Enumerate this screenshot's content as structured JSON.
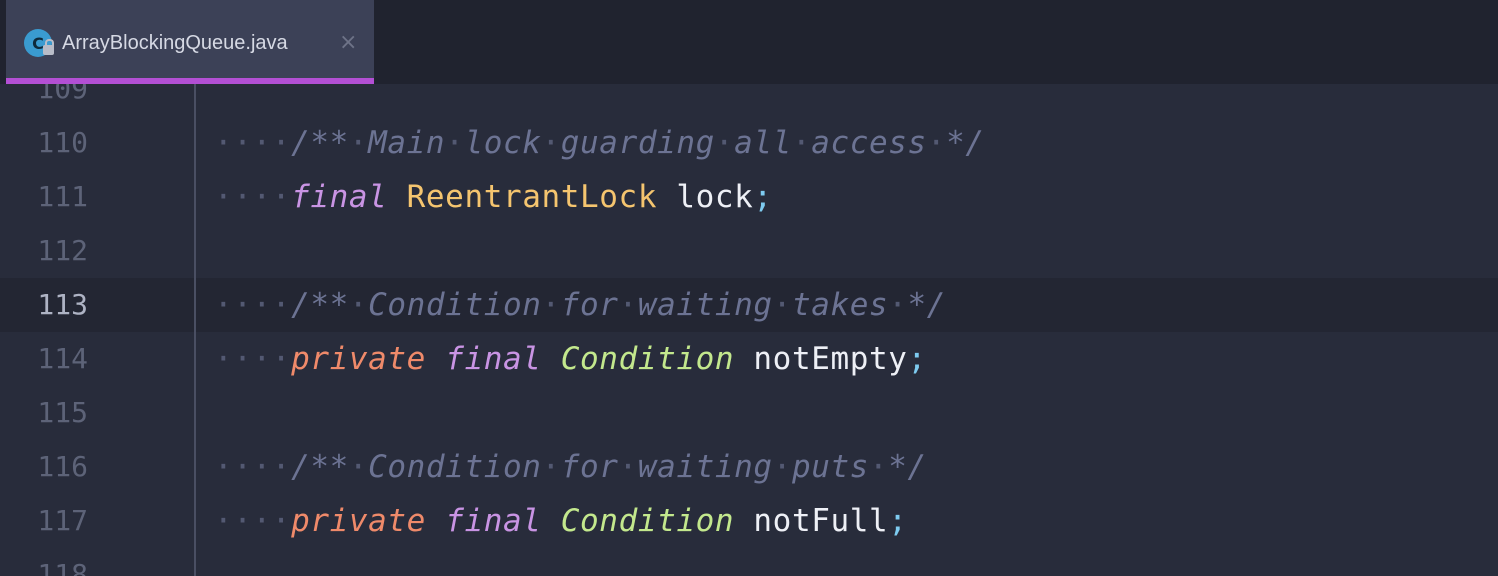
{
  "tab": {
    "file_name": "ArrayBlockingQueue.java",
    "icon_letter": "C",
    "close_symbol": "×",
    "active_color": "#b34fd4"
  },
  "editor": {
    "lines": [
      {
        "number": "109",
        "current": false,
        "tokens": []
      },
      {
        "number": "110",
        "current": false,
        "tokens": [
          {
            "text": "····",
            "kind": "ws"
          },
          {
            "text": "/**",
            "kind": "comment"
          },
          {
            "text": "·",
            "kind": "ws"
          },
          {
            "text": "Main",
            "kind": "comment"
          },
          {
            "text": "·",
            "kind": "ws"
          },
          {
            "text": "lock",
            "kind": "comment"
          },
          {
            "text": "·",
            "kind": "ws"
          },
          {
            "text": "guarding",
            "kind": "comment"
          },
          {
            "text": "·",
            "kind": "ws"
          },
          {
            "text": "all",
            "kind": "comment"
          },
          {
            "text": "·",
            "kind": "ws"
          },
          {
            "text": "access",
            "kind": "comment"
          },
          {
            "text": "·",
            "kind": "ws"
          },
          {
            "text": "*/",
            "kind": "comment"
          }
        ]
      },
      {
        "number": "111",
        "current": false,
        "tokens": [
          {
            "text": "····",
            "kind": "ws"
          },
          {
            "text": "final",
            "kind": "kw-final"
          },
          {
            "text": " ",
            "kind": "ws"
          },
          {
            "text": "ReentrantLock",
            "kind": "type-lock"
          },
          {
            "text": " ",
            "kind": "ws"
          },
          {
            "text": "lock",
            "kind": "ident"
          },
          {
            "text": ";",
            "kind": "semi"
          }
        ]
      },
      {
        "number": "112",
        "current": false,
        "tokens": []
      },
      {
        "number": "113",
        "current": true,
        "tokens": [
          {
            "text": "····",
            "kind": "ws"
          },
          {
            "text": "/**",
            "kind": "comment"
          },
          {
            "text": "·",
            "kind": "ws"
          },
          {
            "text": "Condition",
            "kind": "comment"
          },
          {
            "text": "·",
            "kind": "ws"
          },
          {
            "text": "for",
            "kind": "comment"
          },
          {
            "text": "·",
            "kind": "ws"
          },
          {
            "text": "waiting",
            "kind": "comment"
          },
          {
            "text": "·",
            "kind": "ws"
          },
          {
            "text": "takes",
            "kind": "comment"
          },
          {
            "text": "·",
            "kind": "ws"
          },
          {
            "text": "*/",
            "kind": "comment"
          }
        ]
      },
      {
        "number": "114",
        "current": false,
        "tokens": [
          {
            "text": "····",
            "kind": "ws"
          },
          {
            "text": "private",
            "kind": "kw-private"
          },
          {
            "text": " ",
            "kind": "ws"
          },
          {
            "text": "final",
            "kind": "kw-final"
          },
          {
            "text": " ",
            "kind": "ws"
          },
          {
            "text": "Condition",
            "kind": "type-cond"
          },
          {
            "text": " ",
            "kind": "ws"
          },
          {
            "text": "notEmpty",
            "kind": "ident"
          },
          {
            "text": ";",
            "kind": "semi"
          }
        ]
      },
      {
        "number": "115",
        "current": false,
        "tokens": []
      },
      {
        "number": "116",
        "current": false,
        "tokens": [
          {
            "text": "····",
            "kind": "ws"
          },
          {
            "text": "/**",
            "kind": "comment"
          },
          {
            "text": "·",
            "kind": "ws"
          },
          {
            "text": "Condition",
            "kind": "comment"
          },
          {
            "text": "·",
            "kind": "ws"
          },
          {
            "text": "for",
            "kind": "comment"
          },
          {
            "text": "·",
            "kind": "ws"
          },
          {
            "text": "waiting",
            "kind": "comment"
          },
          {
            "text": "·",
            "kind": "ws"
          },
          {
            "text": "puts",
            "kind": "comment"
          },
          {
            "text": "·",
            "kind": "ws"
          },
          {
            "text": "*/",
            "kind": "comment"
          }
        ]
      },
      {
        "number": "117",
        "current": false,
        "tokens": [
          {
            "text": "····",
            "kind": "ws"
          },
          {
            "text": "private",
            "kind": "kw-private"
          },
          {
            "text": " ",
            "kind": "ws"
          },
          {
            "text": "final",
            "kind": "kw-final"
          },
          {
            "text": " ",
            "kind": "ws"
          },
          {
            "text": "Condition",
            "kind": "type-cond"
          },
          {
            "text": " ",
            "kind": "ws"
          },
          {
            "text": "notFull",
            "kind": "ident"
          },
          {
            "text": ";",
            "kind": "semi"
          }
        ]
      },
      {
        "number": "118",
        "current": false,
        "tokens": []
      }
    ]
  },
  "colors": {
    "background": "#282c3b",
    "current_line": "#232633",
    "comment": "#6c7393",
    "keyword_final": "#c994e4",
    "keyword_private": "#ef8a6a",
    "type_reentrantlock": "#f5c56f",
    "type_condition": "#c3e88d",
    "identifier": "#eef0f6",
    "semicolon": "#7ecbf0"
  }
}
